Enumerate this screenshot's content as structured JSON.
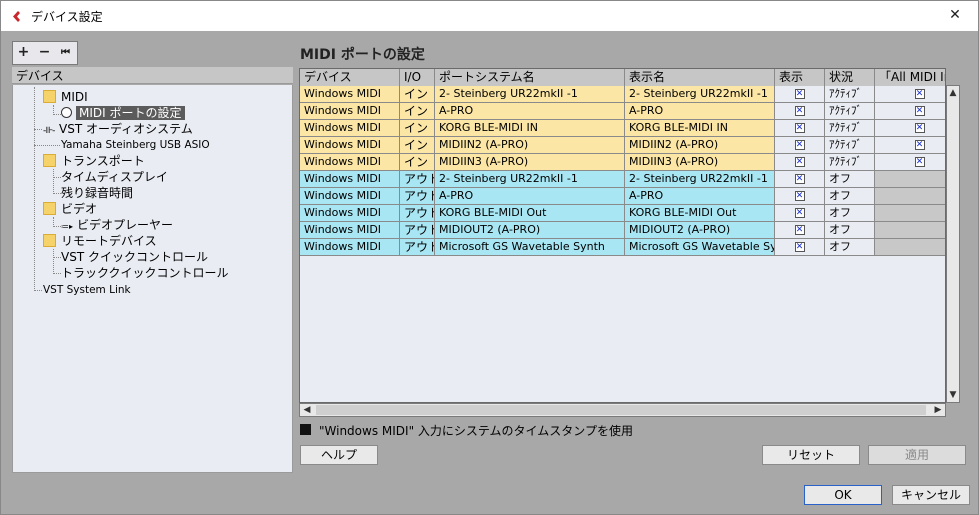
{
  "window": {
    "title": "デバイス設定",
    "close": "✕"
  },
  "left": {
    "toolbar": {
      "add": "+",
      "remove": "−",
      "reset": "⏮"
    },
    "header": "デバイス",
    "tree": {
      "midi": "MIDI",
      "midi_port_settings": "MIDI ポートの設定",
      "vst_audio_system": "VST オーディオシステム",
      "yamaha_driver": "Yamaha Steinberg USB ASIO",
      "transport": "トランスポート",
      "time_display": "タイムディスプレイ",
      "remaining_time": "残り録音時間",
      "video": "ビデオ",
      "video_player": "ビデオプレーヤー",
      "remote_devices": "リモートデバイス",
      "vst_quick_control": "VST クイックコントロール",
      "track_quick_control": "トラッククイックコントロール",
      "vst_system_link": "VST System Link"
    }
  },
  "right": {
    "title": "MIDI ポートの設定",
    "columns": [
      "デバイス",
      "I/O",
      "ポートシステム名",
      "表示名",
      "表示",
      "状況",
      "「All MIDI In"
    ],
    "rows": [
      {
        "device": "Windows MIDI",
        "io": "イン",
        "port": "2- Steinberg UR22mkII -1",
        "display": "2- Steinberg UR22mkII -1",
        "show": "✕",
        "status": "ｱｸﾃｨﾌﾞ",
        "allmidi": "✕",
        "kind": "in"
      },
      {
        "device": "Windows MIDI",
        "io": "イン",
        "port": "A-PRO",
        "display": "A-PRO",
        "show": "✕",
        "status": "ｱｸﾃｨﾌﾞ",
        "allmidi": "✕",
        "kind": "in"
      },
      {
        "device": "Windows MIDI",
        "io": "イン",
        "port": "KORG BLE-MIDI IN",
        "display": "KORG BLE-MIDI IN",
        "show": "✕",
        "status": "ｱｸﾃｨﾌﾞ",
        "allmidi": "✕",
        "kind": "in"
      },
      {
        "device": "Windows MIDI",
        "io": "イン",
        "port": "MIDIIN2 (A-PRO)",
        "display": "MIDIIN2 (A-PRO)",
        "show": "✕",
        "status": "ｱｸﾃｨﾌﾞ",
        "allmidi": "✕",
        "kind": "in"
      },
      {
        "device": "Windows MIDI",
        "io": "イン",
        "port": "MIDIIN3 (A-PRO)",
        "display": "MIDIIN3 (A-PRO)",
        "show": "✕",
        "status": "ｱｸﾃｨﾌﾞ",
        "allmidi": "✕",
        "kind": "in"
      },
      {
        "device": "Windows MIDI",
        "io": "アウト",
        "port": "2- Steinberg UR22mkII -1",
        "display": "2- Steinberg UR22mkII -1",
        "show": "✕",
        "status": "オフ",
        "allmidi": "",
        "kind": "out"
      },
      {
        "device": "Windows MIDI",
        "io": "アウト",
        "port": "A-PRO",
        "display": "A-PRO",
        "show": "✕",
        "status": "オフ",
        "allmidi": "",
        "kind": "out"
      },
      {
        "device": "Windows MIDI",
        "io": "アウト",
        "port": "KORG BLE-MIDI Out",
        "display": "KORG BLE-MIDI Out",
        "show": "✕",
        "status": "オフ",
        "allmidi": "",
        "kind": "out"
      },
      {
        "device": "Windows MIDI",
        "io": "アウト",
        "port": "MIDIOUT2 (A-PRO)",
        "display": "MIDIOUT2 (A-PRO)",
        "show": "✕",
        "status": "オフ",
        "allmidi": "",
        "kind": "out"
      },
      {
        "device": "Windows MIDI",
        "io": "アウト",
        "port": "Microsoft GS Wavetable Synth",
        "display": "Microsoft GS Wavetable Synt",
        "show": "✕",
        "status": "オフ",
        "allmidi": "",
        "kind": "out"
      }
    ],
    "timestamp_label": "\"Windows MIDI\" 入力にシステムのタイムスタンプを使用",
    "scroll": {
      "up": "▲",
      "down": "▼",
      "left": "◀",
      "right": "▶"
    }
  },
  "buttons": {
    "help": "ヘルプ",
    "reset": "リセット",
    "apply": "適用",
    "ok": "OK",
    "cancel": "キャンセル"
  }
}
